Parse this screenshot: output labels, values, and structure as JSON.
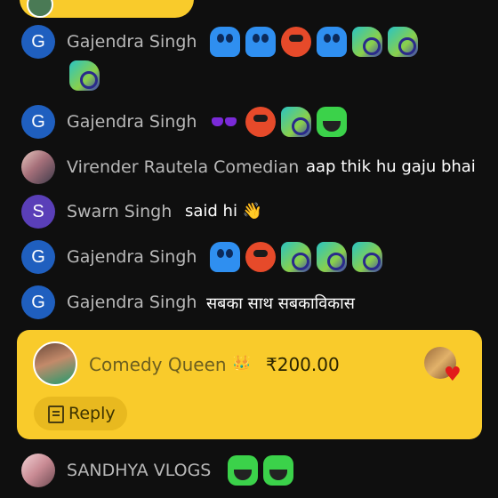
{
  "top_pill": {
    "text": ""
  },
  "chat": [
    {
      "avatar_letter": "G",
      "name": "Gajendra Singh",
      "message": "",
      "emojis": [
        "blue-ghost",
        "blue-ghost",
        "red-face",
        "blue-ghost",
        "snail",
        "snail",
        "snail"
      ]
    },
    {
      "avatar_letter": "G",
      "name": "Gajendra Singh",
      "message": "",
      "emojis": [
        "sunglasses",
        "red-face",
        "snail",
        "green-laugh"
      ]
    },
    {
      "avatar_letter": "",
      "name": "Virender Rautela Comedian",
      "message": "aap thik hu gaju bhai"
    },
    {
      "avatar_letter": "S",
      "name": "Swarn Singh",
      "message": "said hi 👋"
    },
    {
      "avatar_letter": "G",
      "name": "Gajendra Singh",
      "message": "",
      "emojis": [
        "blue-ghost",
        "red-face",
        "snail",
        "snail",
        "snail"
      ]
    },
    {
      "avatar_letter": "G",
      "name": "Gajendra Singh",
      "message": "सबका साथ सबकाविकास"
    }
  ],
  "super_chat": {
    "name": "Comedy Queen",
    "crown": "👑",
    "amount": "₹200.00",
    "reply_label": "Reply",
    "accent": "#f9cb2b"
  },
  "last_message": {
    "name": "SANDHYA VLOGS",
    "emojis": [
      "green-laugh",
      "green-laugh"
    ]
  }
}
